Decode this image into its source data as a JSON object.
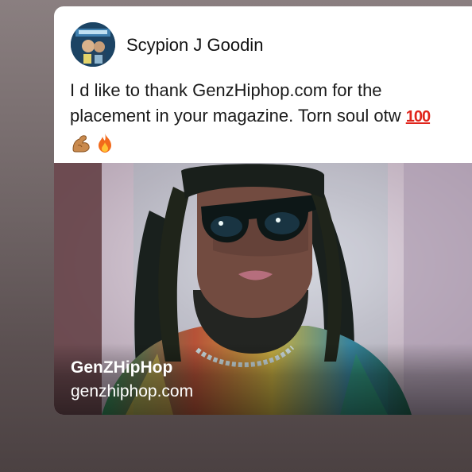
{
  "post": {
    "author": "Scypion J Goodin",
    "text_line_1": "I d like to thank GenzHiphop.com for the",
    "text_line_2": "placement in your  magazine.  Torn soul otw ",
    "emoji_100": "100",
    "emojis_line_3": [
      "flexed-biceps-icon",
      "fire-icon"
    ]
  },
  "link_preview": {
    "title": "GenZHipHop",
    "domain": "genzhiphop.com"
  },
  "colors": {
    "card_background": "#ffffff",
    "text": "#1a1a1a",
    "emoji_100_red": "#e0241b",
    "link_text": "#ffffff"
  }
}
